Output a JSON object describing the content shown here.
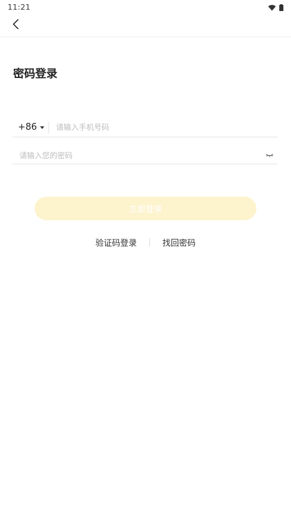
{
  "status_bar": {
    "time": "11:21",
    "icons": [
      "wifi-icon",
      "battery-icon"
    ]
  },
  "nav": {
    "back_icon": "chevron-left-icon"
  },
  "page": {
    "title": "密码登录"
  },
  "form": {
    "country_code": "+86",
    "phone": {
      "value": "",
      "placeholder": "请输入手机号码"
    },
    "password": {
      "value": "",
      "placeholder": "请输入您的密码"
    },
    "password_toggle_icon": "eye-closed-icon",
    "submit_label": "立即登录"
  },
  "links": {
    "sms_login": "验证码登录",
    "find_password": "找回密码"
  },
  "colors": {
    "accent_disabled": "#fdf3cd",
    "text_primary": "#222222",
    "placeholder": "#bdbdbd",
    "divider": "#e6e6e6"
  }
}
